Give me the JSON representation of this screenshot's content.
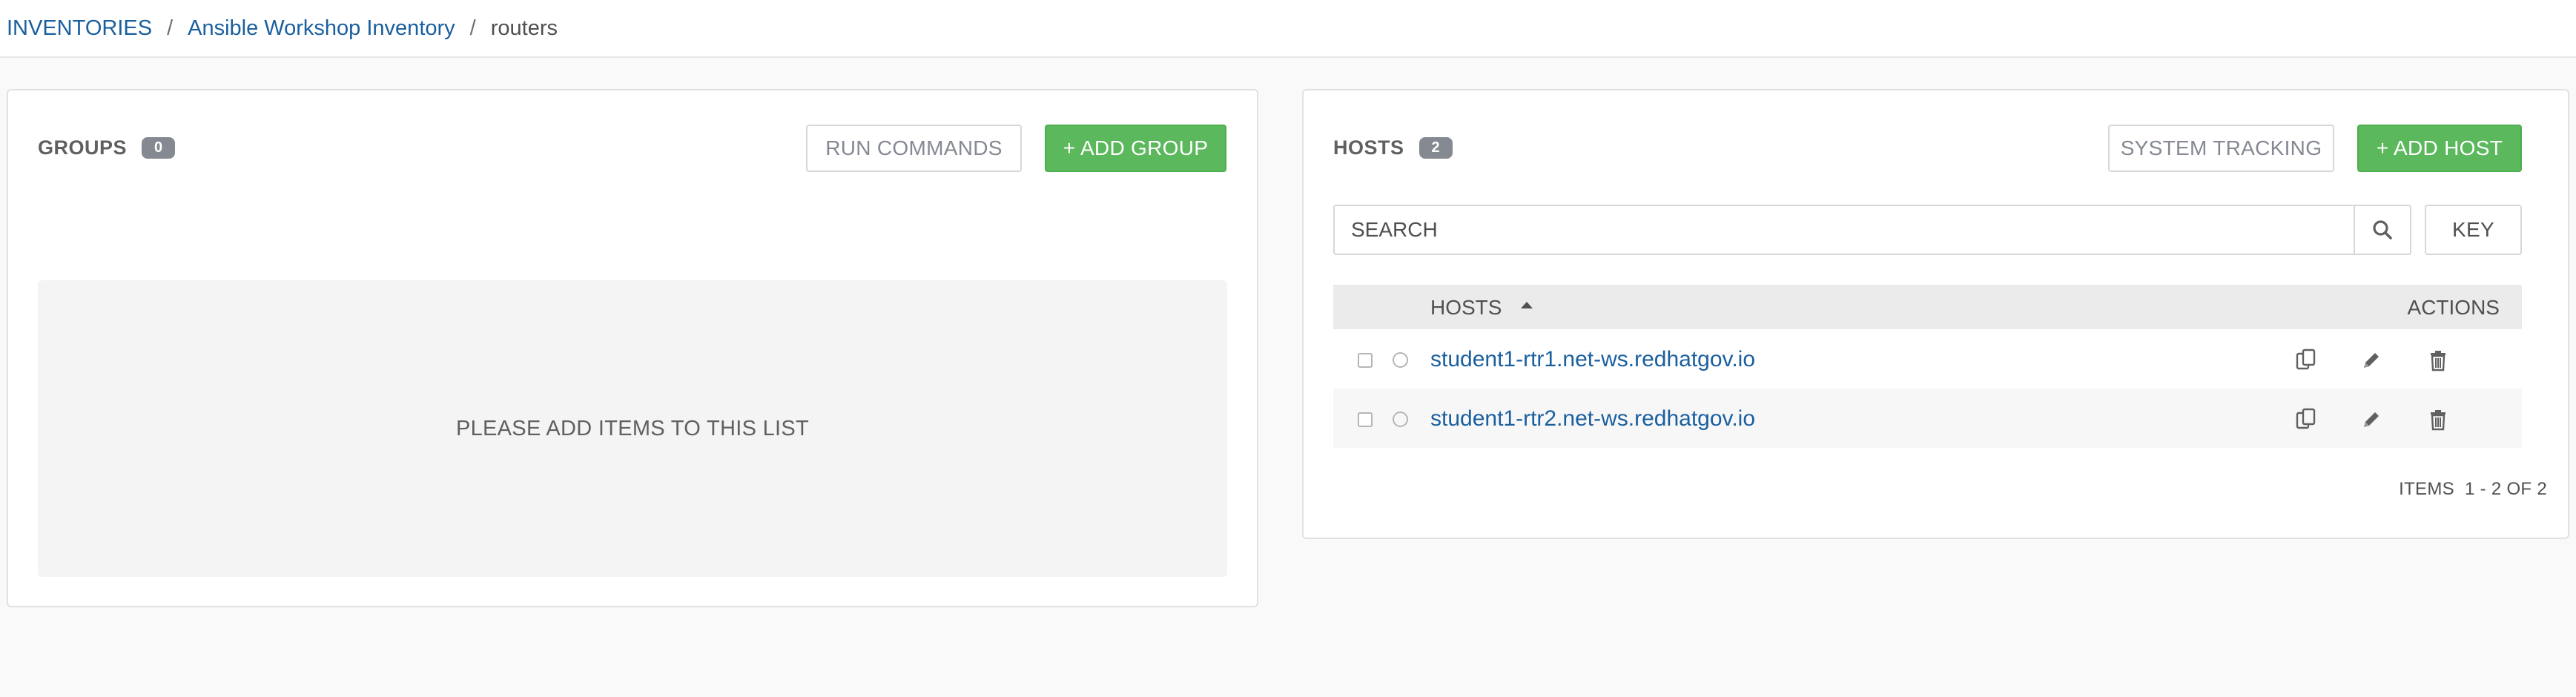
{
  "breadcrumb": {
    "items": [
      "INVENTORIES",
      "Ansible Workshop Inventory"
    ],
    "separator": "/",
    "current": "routers"
  },
  "groups": {
    "title": "GROUPS",
    "count": "0",
    "run_commands_label": "RUN COMMANDS",
    "add_group_label": "+ ADD GROUP",
    "empty_message": "PLEASE ADD ITEMS TO THIS LIST"
  },
  "hosts": {
    "title": "HOSTS",
    "count": "2",
    "system_tracking_label": "SYSTEM TRACKING",
    "add_host_label": "+ ADD HOST",
    "search_placeholder": "SEARCH",
    "key_label": "KEY",
    "columns": {
      "name": "HOSTS",
      "actions": "ACTIONS"
    },
    "rows": [
      {
        "name": "student1-rtr1.net-ws.redhatgov.io"
      },
      {
        "name": "student1-rtr2.net-ws.redhatgov.io"
      }
    ],
    "pagination": {
      "label": "ITEMS",
      "range": "1 - 2 OF 2"
    }
  },
  "colors": {
    "link": "#1a5f9e",
    "success": "#5cb85c",
    "badge": "#848992",
    "muted_button_text": "#848992"
  },
  "icons": [
    "search-icon",
    "sort-asc-icon",
    "copy-icon",
    "edit-icon",
    "delete-icon"
  ]
}
